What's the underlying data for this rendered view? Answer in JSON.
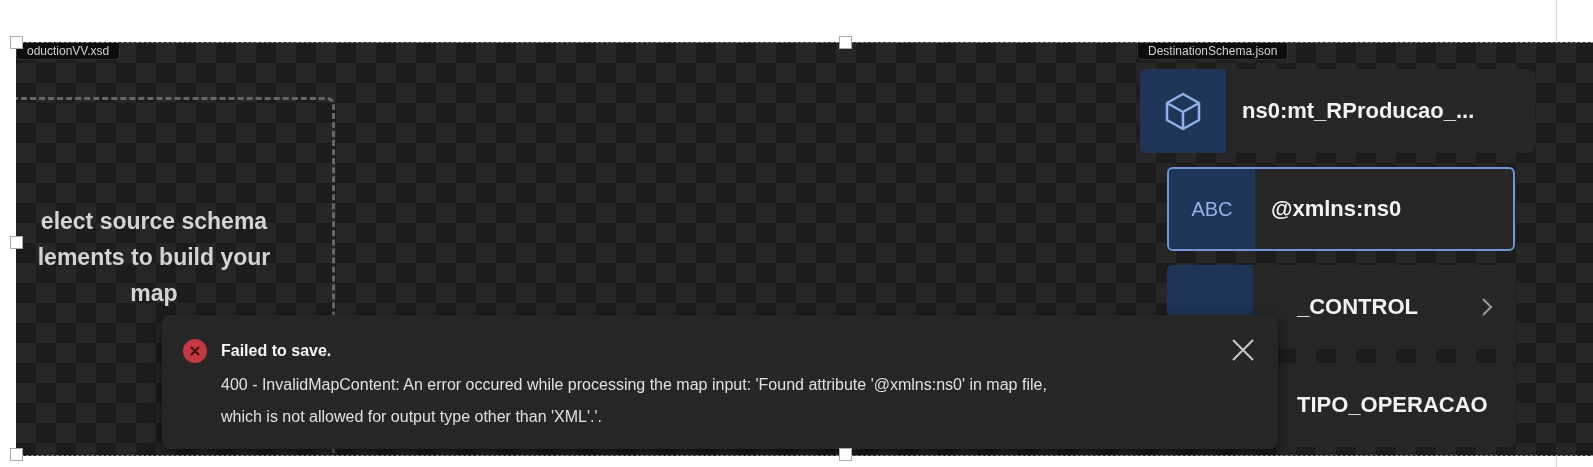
{
  "source_tab": {
    "label": "oductionVV.xsd"
  },
  "source_hint": {
    "lines": [
      "elect source schema",
      "lements to build your",
      "map"
    ]
  },
  "destination_tab": {
    "label": "DestinationSchema.json"
  },
  "nodes": [
    {
      "kind": "object",
      "label": "ns0:mt_RProducao_...",
      "selected": false,
      "nested": false,
      "expandable": false
    },
    {
      "kind": "string",
      "icon_text": "ABC",
      "label": "@xmlns:ns0",
      "selected": true,
      "nested": true,
      "expandable": false
    },
    {
      "kind": "string",
      "label": "_CONTROL",
      "selected": false,
      "nested": true,
      "expandable": true
    },
    {
      "kind": "string",
      "label": "TIPO_OPERACAO",
      "selected": false,
      "nested": true,
      "expandable": false
    }
  ],
  "toast": {
    "kind": "error",
    "title": "Failed to save.",
    "message": "400 - InvalidMapContent: An error occured while processing the map input: 'Found attribute '@xmlns:ns0' in map file, which is not allowed for output type other than 'XML'.'."
  }
}
